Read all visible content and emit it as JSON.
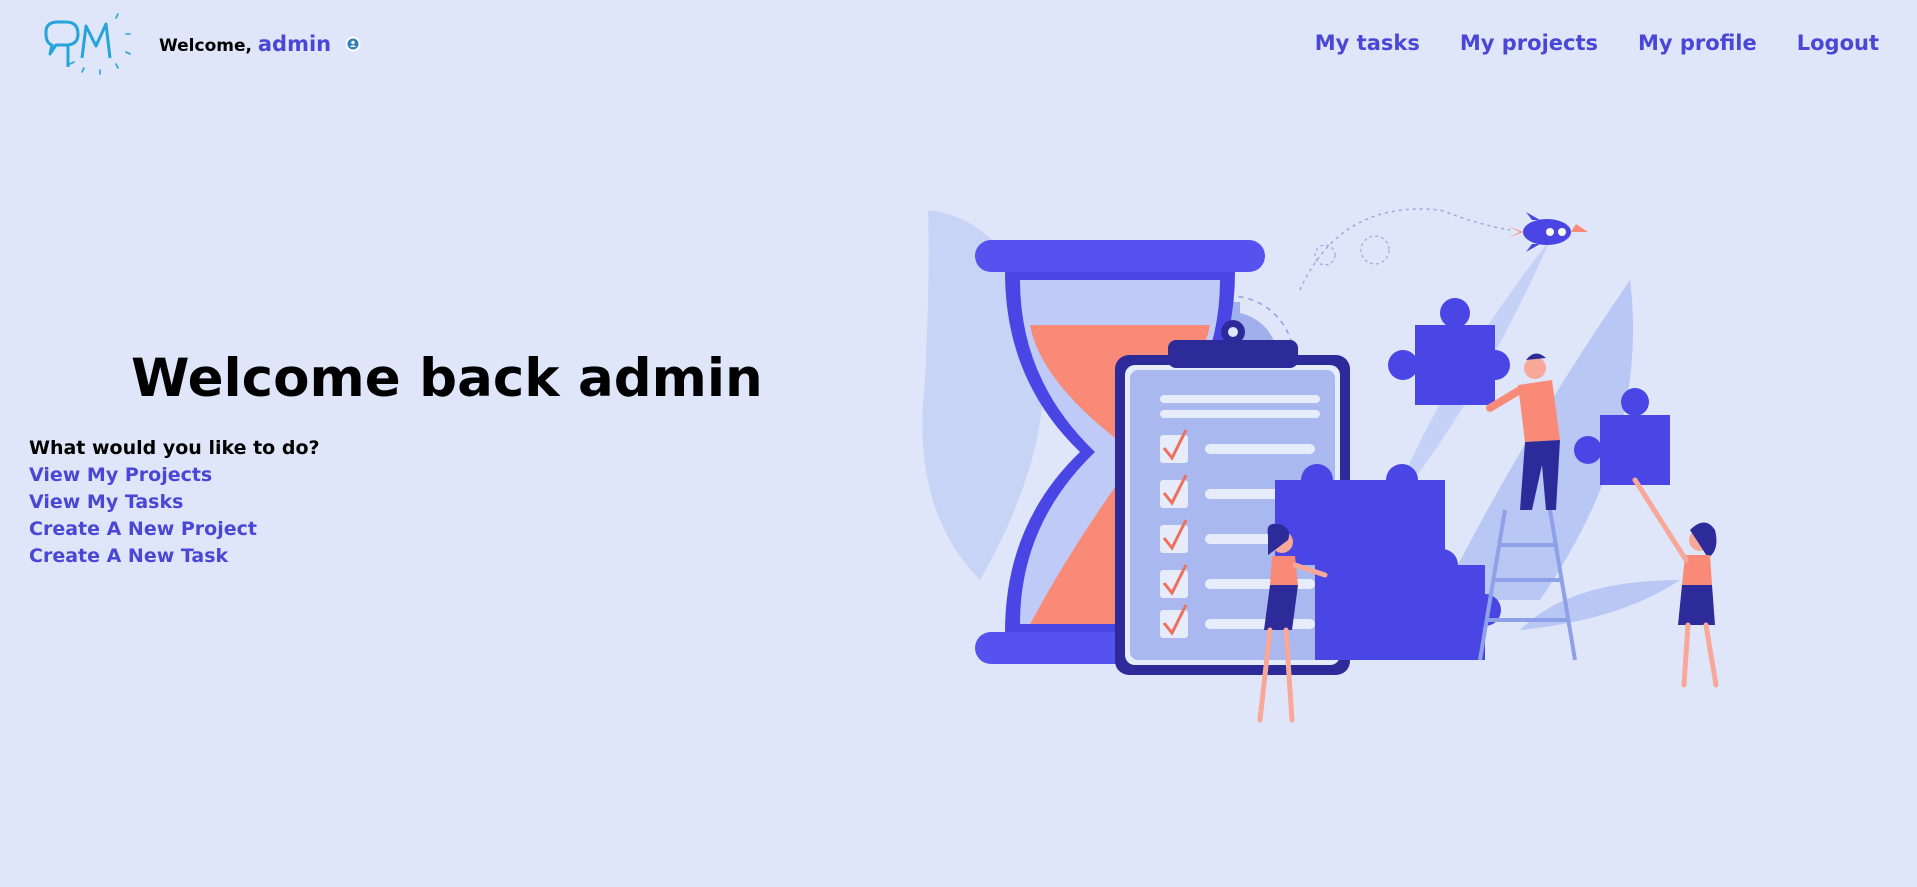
{
  "header": {
    "welcome_prefix": "Welcome,",
    "username": "admin",
    "nav": [
      {
        "label": "My tasks"
      },
      {
        "label": "My projects"
      },
      {
        "label": "My profile"
      },
      {
        "label": "Logout"
      }
    ]
  },
  "main": {
    "title": "Welcome back admin",
    "prompt": "What would you like to do?",
    "links": [
      {
        "label": "View My Projects"
      },
      {
        "label": "View My Tasks"
      },
      {
        "label": "Create A New Project"
      },
      {
        "label": "Create A New Task"
      }
    ]
  },
  "colors": {
    "background": "#e0e6f9",
    "accent": "#4a46d6",
    "logo": "#25a4dc",
    "illustration_blue": "#4a46e6",
    "illustration_coral": "#f98a78"
  },
  "icons": {
    "logo": "pm-logo",
    "badge": "user-badge-icon"
  }
}
